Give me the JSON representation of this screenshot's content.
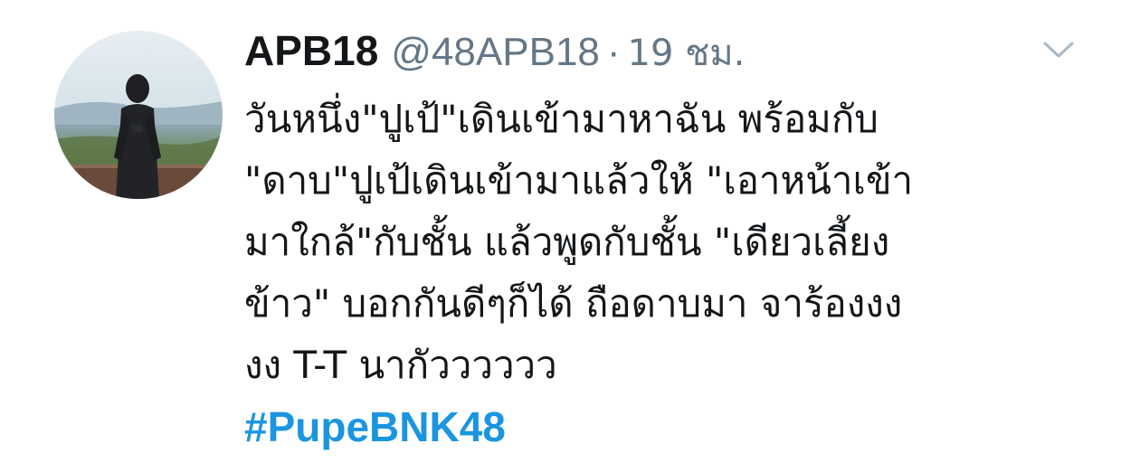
{
  "tweet": {
    "author": {
      "display_name": "APB18",
      "handle": "@48APB18",
      "avatar": "profile-photo-person-on-hilltop"
    },
    "separator": "·",
    "timestamp": "19 ชม.",
    "text_lines": [
      "วันหนึ่ง\"ปูเป้\"เดินเข้ามาหาฉัน พร้อมกับ",
      "\"ดาบ\"ปูเป้เดินเข้ามาแล้วให้ \"เอาหน้าเข้า",
      "มาใกล้\"กับชั้น แล้วพูดกับชั้น \"เดียวเลี้ยง",
      "ข้าว\" บอกกันดีๆก็ได้ ถือดาบมา จาร้องงง",
      "งง T-T นากัวววววว"
    ],
    "hashtag": "#PupeBNK48",
    "menu_icon": "chevron-down-icon"
  },
  "colors": {
    "name": "#14171a",
    "secondary": "#657786",
    "link": "#1b95e0",
    "caret": "#aab8c2"
  }
}
